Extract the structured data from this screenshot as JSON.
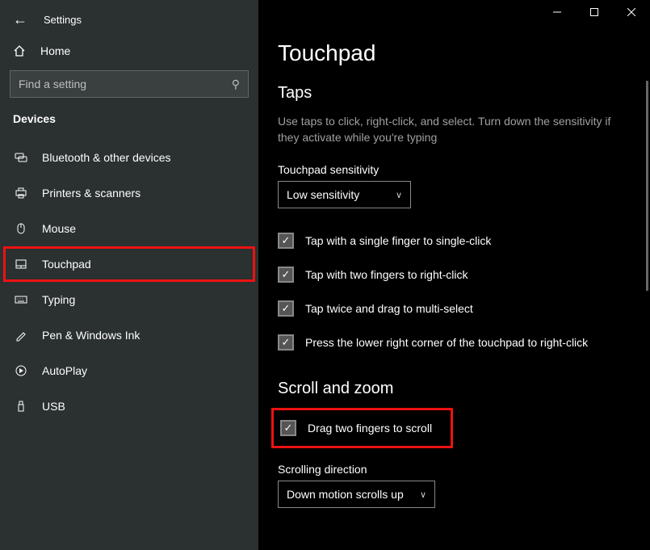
{
  "header": {
    "app_title": "Settings"
  },
  "sidebar": {
    "home_label": "Home",
    "search_placeholder": "Find a setting",
    "section_label": "Devices",
    "items": [
      {
        "label": "Bluetooth & other devices"
      },
      {
        "label": "Printers & scanners"
      },
      {
        "label": "Mouse"
      },
      {
        "label": "Touchpad"
      },
      {
        "label": "Typing"
      },
      {
        "label": "Pen & Windows Ink"
      },
      {
        "label": "AutoPlay"
      },
      {
        "label": "USB"
      }
    ]
  },
  "main": {
    "page_title": "Touchpad",
    "taps": {
      "heading": "Taps",
      "description": "Use taps to click, right-click, and select. Turn down the sensitivity if they activate while you're typing",
      "sensitivity_label": "Touchpad sensitivity",
      "sensitivity_value": "Low sensitivity",
      "checks": [
        "Tap with a single finger to single-click",
        "Tap with two fingers to right-click",
        "Tap twice and drag to multi-select",
        "Press the lower right corner of the touchpad to right-click"
      ]
    },
    "scroll": {
      "heading": "Scroll and zoom",
      "check_drag": "Drag two fingers to scroll",
      "direction_label": "Scrolling direction",
      "direction_value": "Down motion scrolls up"
    }
  }
}
